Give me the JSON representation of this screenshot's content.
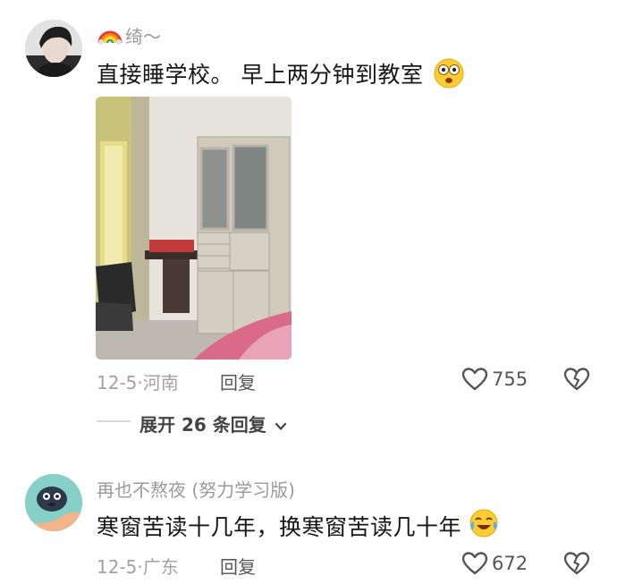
{
  "comments": [
    {
      "username": "绮～",
      "username_badge": "rainbow-emoji",
      "text": "直接睡学校。 早上两分钟到教室",
      "emoji": "goofy-face-emoji",
      "date": "12-5",
      "location": "河南",
      "reply_label": "回复",
      "likes": "755"
    },
    {
      "username": "再也不熬夜 (努力学习版)",
      "text": "寒窗苦读十几年，换寒窗苦读几十年",
      "emoji": "tears-of-joy-emoji",
      "date": "12-5",
      "location": "广东",
      "reply_label": "回复",
      "likes": "672"
    }
  ],
  "expand_replies": {
    "label": "展开 26 条回复"
  },
  "colors": {
    "meta_gray": "#a2a2a2",
    "text_dark": "#161616",
    "like_gray": "#555555"
  }
}
